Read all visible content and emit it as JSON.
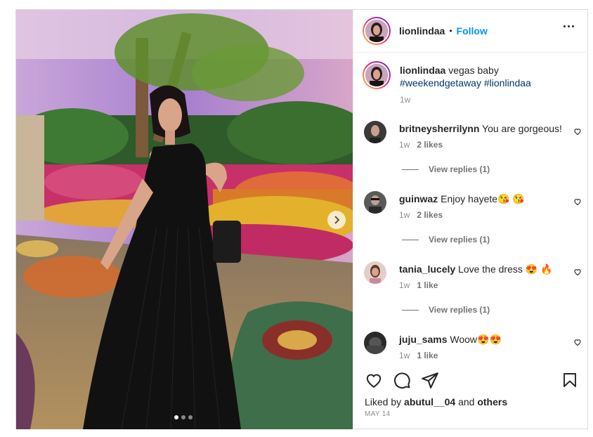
{
  "post": {
    "username": "lionlindaa",
    "separator": "•",
    "follow_label": "Follow",
    "caption_text": "vegas baby",
    "caption_tags": [
      "#weekendgetaway",
      "#lionlindaa"
    ],
    "caption_time": "1w",
    "carousel": {
      "slides": 3,
      "active_index": 0
    }
  },
  "comments": [
    {
      "username": "britneysherrilynn",
      "text": "You are gorgeous!",
      "time": "1w",
      "likes": "2 likes",
      "replies": "View replies (1)"
    },
    {
      "username": "guinwaz",
      "text": "Enjoy hayete😘 😘",
      "time": "1w",
      "likes": "2 likes",
      "replies": "View replies (1)"
    },
    {
      "username": "tania_lucely",
      "text": "Love the dress 😍 🔥",
      "time": "1w",
      "likes": "1 like",
      "replies": "View replies (1)"
    },
    {
      "username": "juju_sams",
      "text": "Woow😍😍",
      "time": "1w",
      "likes": "1 like",
      "replies": ""
    }
  ],
  "footer": {
    "liked_prefix": "Liked by",
    "liked_user": "abutul__04",
    "liked_and": "and",
    "liked_others": "others",
    "date": "MAY 14"
  },
  "icons": {
    "like": "heart-icon",
    "comment": "comment-icon",
    "share": "share-icon",
    "save": "bookmark-icon",
    "more": "more-options-icon",
    "next": "chevron-right-icon"
  },
  "colors": {
    "accent": "#0095f6",
    "hashtag": "#00376b",
    "muted": "#8e8e8e",
    "dress": "#111111"
  }
}
